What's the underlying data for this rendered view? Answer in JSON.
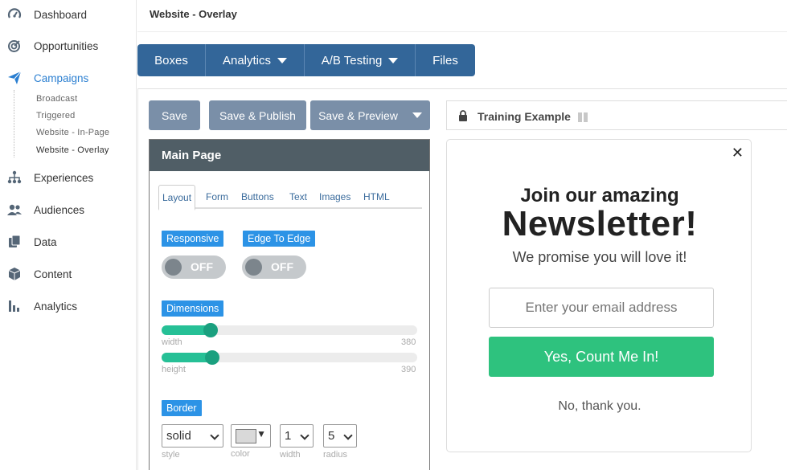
{
  "sidebar": {
    "items": [
      {
        "label": "Dashboard",
        "icon": "gauge-icon"
      },
      {
        "label": "Opportunities",
        "icon": "target-icon"
      },
      {
        "label": "Campaigns",
        "icon": "paper-plane-icon"
      },
      {
        "label": "Experiences",
        "icon": "sitemap-icon"
      },
      {
        "label": "Audiences",
        "icon": "users-icon"
      },
      {
        "label": "Data",
        "icon": "copy-icon"
      },
      {
        "label": "Content",
        "icon": "cube-icon"
      },
      {
        "label": "Analytics",
        "icon": "bar-chart-icon"
      }
    ],
    "campaign_subitems": [
      "Broadcast",
      "Triggered",
      "Website - In-Page",
      "Website - Overlay"
    ],
    "active_color": "#2b7fd1"
  },
  "header": {
    "title": "Website - Overlay"
  },
  "tabs": [
    {
      "label": "Boxes"
    },
    {
      "label": "Analytics"
    },
    {
      "label": "A/B Testing"
    },
    {
      "label": "Files"
    }
  ],
  "actions": {
    "save": "Save",
    "save_publish": "Save & Publish",
    "save_preview": "Save & Preview"
  },
  "editor": {
    "title": "Main Page",
    "tabs": [
      "Layout",
      "Form",
      "Buttons",
      "Text",
      "Images",
      "HTML"
    ],
    "responsive_label": "Responsive",
    "responsive_value": "OFF",
    "edge_label": "Edge To Edge",
    "edge_value": "OFF",
    "dimensions_label": "Dimensions",
    "width_label": "width",
    "width_value": "380",
    "height_label": "height",
    "height_value": "390",
    "border_label": "Border",
    "border_style": "solid",
    "border_style_label": "style",
    "border_color_label": "color",
    "border_width": "1",
    "border_width_label": "width",
    "border_radius": "5",
    "border_radius_label": "radius"
  },
  "preview": {
    "title": "Training Example",
    "popup": {
      "heading_small": "Join our amazing",
      "heading_large": "Newsletter!",
      "subheading": "We promise you will love it!",
      "email_placeholder": "Enter your email address",
      "cta": "Yes, Count Me In!",
      "decline": "No, thank you.",
      "cta_color": "#2ec27e"
    }
  }
}
